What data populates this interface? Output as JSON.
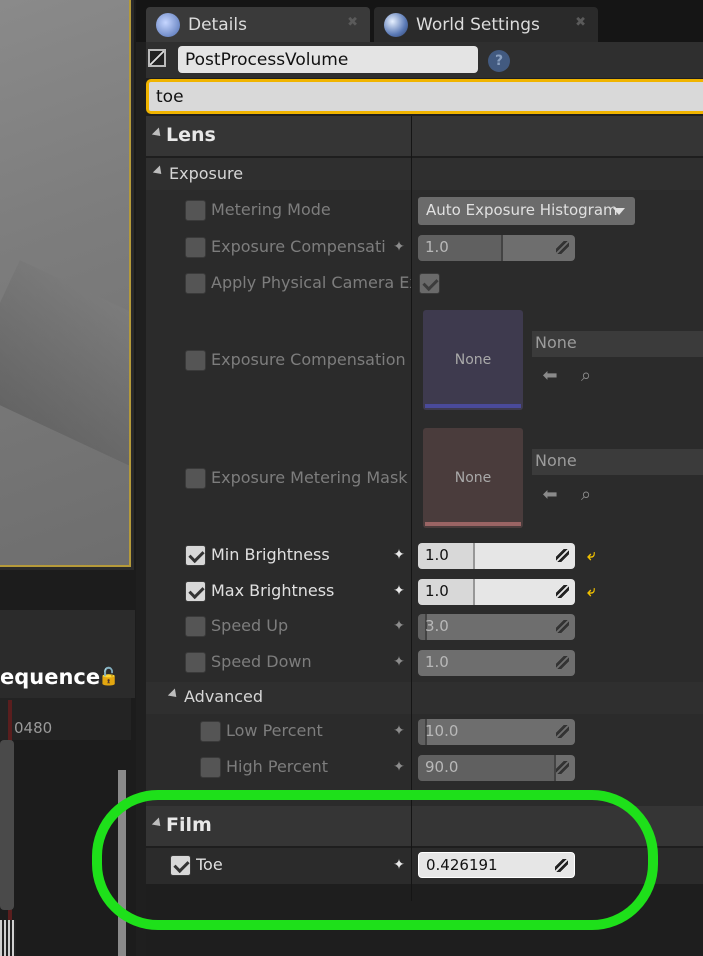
{
  "tabs": [
    {
      "label": "Details",
      "icon": "details-icon"
    },
    {
      "label": "World Settings",
      "icon": "globe-icon"
    }
  ],
  "object_name": "PostProcessVolume",
  "search_value": "toe",
  "sequencer": {
    "title": "equence",
    "time_readout": "0480"
  },
  "lens": {
    "label": "Lens",
    "exposure": {
      "label": "Exposure",
      "metering_mode": {
        "label": "Metering Mode",
        "value": "Auto Exposure Histogram"
      },
      "exposure_compensation": {
        "label": "Exposure Compensation",
        "value": "1.0"
      },
      "apply_physical_camera": {
        "label": "Apply Physical Camera Expo"
      },
      "compensation_curve": {
        "label": "Exposure Compensation Cur",
        "thumb": "None",
        "asset": "None"
      },
      "metering_mask": {
        "label": "Exposure Metering Mask",
        "thumb": "None",
        "asset": "None"
      },
      "min_brightness": {
        "label": "Min Brightness",
        "value": "1.0"
      },
      "max_brightness": {
        "label": "Max Brightness",
        "value": "1.0"
      },
      "speed_up": {
        "label": "Speed Up",
        "value": "3.0"
      },
      "speed_down": {
        "label": "Speed Down",
        "value": "1.0"
      },
      "advanced": {
        "label": "Advanced",
        "low_percent": {
          "label": "Low Percent",
          "value": "10.0"
        },
        "high_percent": {
          "label": "High Percent",
          "value": "90.0"
        }
      }
    }
  },
  "film": {
    "label": "Film",
    "toe": {
      "label": "Toe",
      "value": "0.426191"
    }
  },
  "colors": {
    "accent": "#f0b400",
    "highlight": "#1ee01a",
    "reset": "#f0c000"
  }
}
